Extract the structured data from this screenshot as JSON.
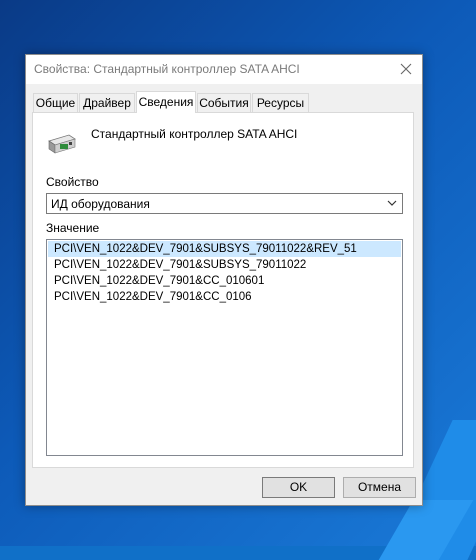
{
  "window": {
    "title": "Свойства: Стандартный контроллер SATA AHCI"
  },
  "tabs": [
    {
      "label": "Общие"
    },
    {
      "label": "Драйвер"
    },
    {
      "label": "Сведения",
      "active": true
    },
    {
      "label": "События"
    },
    {
      "label": "Ресурсы"
    }
  ],
  "details": {
    "device_name": "Стандартный контроллер SATA AHCI",
    "device_icon": "storage-controller-icon",
    "property_label": "Свойство",
    "property_value": "ИД оборудования",
    "value_label": "Значение",
    "values": [
      "PCI\\VEN_1022&DEV_7901&SUBSYS_79011022&REV_51",
      "PCI\\VEN_1022&DEV_7901&SUBSYS_79011022",
      "PCI\\VEN_1022&DEV_7901&CC_010601",
      "PCI\\VEN_1022&DEV_7901&CC_0106"
    ]
  },
  "buttons": {
    "ok": "OK",
    "cancel": "Отмена"
  },
  "colors": {
    "selection": "#cce8ff",
    "desktop": "#1070c8"
  }
}
